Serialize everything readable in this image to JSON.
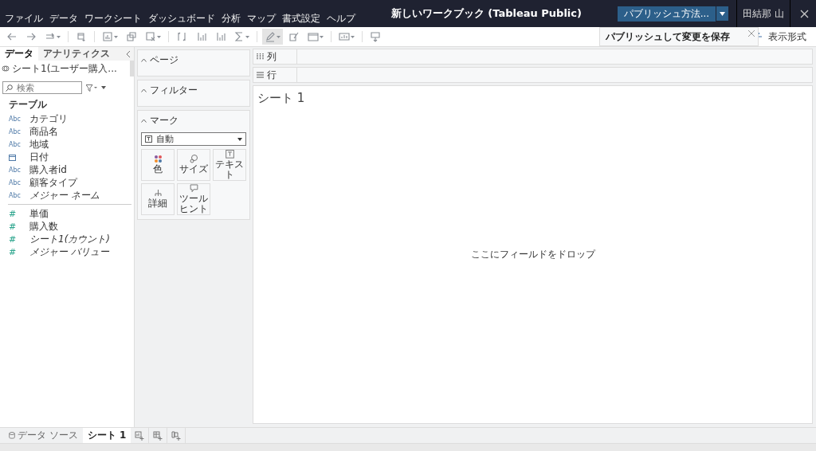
{
  "menu": [
    "ファイル",
    "データ",
    "ワークシート",
    "ダッシュボード",
    "分析",
    "マップ",
    "書式設定",
    "ヘルプ"
  ],
  "window": {
    "title": "新しいワークブック (Tableau Public)"
  },
  "publish_button": {
    "label": "パブリッシュ方法..."
  },
  "user": "田結那 山",
  "popup": {
    "text": "パブリッシュして変更を保存"
  },
  "show_me": {
    "label": "表示形式"
  },
  "left_tabs": [
    {
      "label": "データ",
      "selected": true
    },
    {
      "label": "アナリティクス",
      "selected": false
    }
  ],
  "data_source": "シート1(ユーザー購入...",
  "search": {
    "placeholder": "検索"
  },
  "table_heading": "テーブル",
  "fields": [
    {
      "kind": "dimension",
      "type_label": "Abc",
      "name": "カテゴリ",
      "generated": false
    },
    {
      "kind": "dimension",
      "type_label": "Abc",
      "name": "商品名",
      "generated": false
    },
    {
      "kind": "dimension",
      "type_label": "Abc",
      "name": "地域",
      "generated": false
    },
    {
      "kind": "date",
      "name": "日付",
      "generated": false
    },
    {
      "kind": "dimension",
      "type_label": "Abc",
      "name": "購入者id",
      "generated": false
    },
    {
      "kind": "dimension",
      "type_label": "Abc",
      "name": "顧客タイプ",
      "generated": false
    },
    {
      "kind": "dimension",
      "type_label": "Abc",
      "name": "メジャー ネーム",
      "generated": true
    },
    {
      "kind": "measure",
      "type_label": "#",
      "name": "単価",
      "generated": false
    },
    {
      "kind": "measure",
      "type_label": "#",
      "name": "購入数",
      "generated": false
    },
    {
      "kind": "measure",
      "type_label": "#",
      "name": "シート1(カウント)",
      "generated": true
    },
    {
      "kind": "measure",
      "type_label": "#",
      "name": "メジャー バリュー",
      "generated": true
    }
  ],
  "cards": {
    "pages": "ページ",
    "filters": "フィルター",
    "marks": "マーク"
  },
  "mark_type": "自動",
  "mark_buttons": [
    {
      "kind": "color",
      "label": "色"
    },
    {
      "kind": "size",
      "label": "サイズ"
    },
    {
      "kind": "text",
      "label": "テキスト"
    },
    {
      "kind": "detail",
      "label": "詳細"
    },
    {
      "kind": "tooltip",
      "label": "ツールヒント"
    }
  ],
  "shelves": [
    {
      "kind": "columns",
      "label": "列"
    },
    {
      "kind": "rows",
      "label": "行"
    }
  ],
  "sheet_title": "シート 1",
  "drop_hint": "ここにフィールドをドロップ",
  "bottom_tabs": [
    {
      "kind": "source",
      "label": "データ ソース",
      "selected": false
    },
    {
      "kind": "sheet",
      "label": "シート 1",
      "selected": true
    }
  ]
}
